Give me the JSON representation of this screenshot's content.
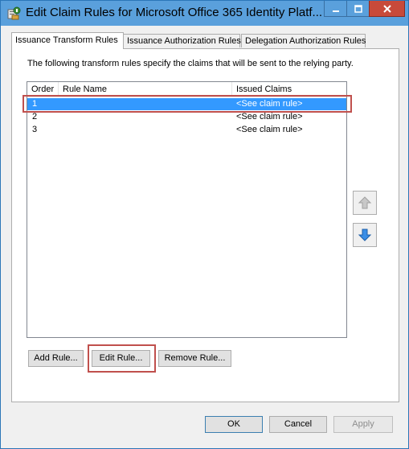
{
  "window": {
    "title": "Edit Claim Rules for Microsoft Office 365 Identity Platf...",
    "accent_color": "#5aa0dc",
    "close_color": "#c84a3a"
  },
  "tabs": [
    {
      "label": "Issuance Transform Rules",
      "active": true
    },
    {
      "label": "Issuance Authorization Rules",
      "active": false
    },
    {
      "label": "Delegation Authorization Rules",
      "active": false
    }
  ],
  "description": "The following transform rules specify the claims that will be sent to the relying party.",
  "rules_table": {
    "columns": [
      "Order",
      "Rule Name",
      "Issued Claims"
    ],
    "rows": [
      {
        "order": "1",
        "name": "",
        "claims": "<See claim rule>",
        "selected": true
      },
      {
        "order": "2",
        "name": "",
        "claims": "<See claim rule>",
        "selected": false
      },
      {
        "order": "3",
        "name": "",
        "claims": "<See claim rule>",
        "selected": false
      }
    ],
    "selection_color": "#3399ff"
  },
  "rule_buttons": {
    "add": "Add Rule...",
    "edit": "Edit Rule...",
    "remove": "Remove Rule..."
  },
  "move_buttons": {
    "up_icon": "arrow-up-icon",
    "down_icon": "arrow-down-icon"
  },
  "dialog_buttons": {
    "ok": "OK",
    "cancel": "Cancel",
    "apply": "Apply"
  },
  "highlight_color": "#c0504d"
}
